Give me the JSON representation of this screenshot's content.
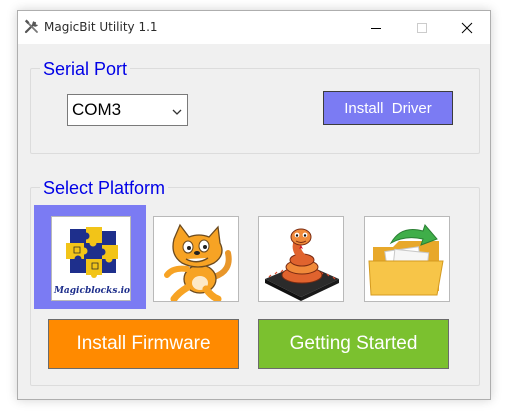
{
  "window": {
    "title": "MagicBit Utility 1.1"
  },
  "serial": {
    "legend": "Serial Port",
    "port_value": "COM3",
    "install_driver_label": "Install  Driver"
  },
  "platform": {
    "legend": "Select Platform",
    "tiles": [
      {
        "name": "magicblocks",
        "caption": "Magicblocks.io",
        "selected": true
      },
      {
        "name": "scratch",
        "selected": false
      },
      {
        "name": "micropython",
        "selected": false
      },
      {
        "name": "file-folder",
        "selected": false
      }
    ],
    "install_firmware_label": "Install Firmware",
    "getting_started_label": "Getting Started"
  },
  "colors": {
    "accent_blue": "#7b7bf3",
    "legend_blue": "#0000e6",
    "firmware_orange": "#ff8a00",
    "started_green": "#7bc12f"
  }
}
